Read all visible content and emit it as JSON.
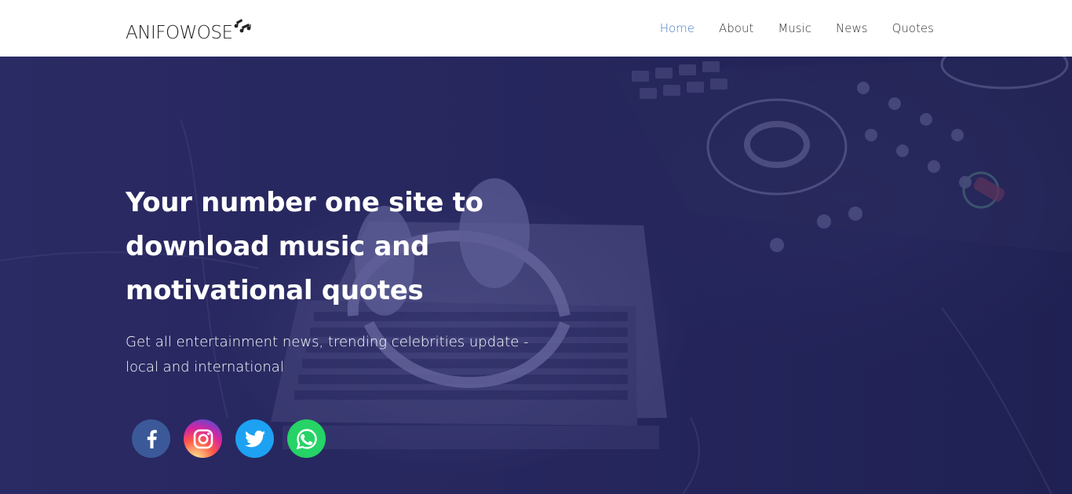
{
  "brand": {
    "name": "ANIFOWOSE"
  },
  "nav": {
    "items": [
      {
        "label": "Home",
        "active": true
      },
      {
        "label": "About",
        "active": false
      },
      {
        "label": "Music",
        "active": false
      },
      {
        "label": "News",
        "active": false
      },
      {
        "label": "Quotes",
        "active": false
      }
    ]
  },
  "hero": {
    "title": "Your number one site to download music and motivational quotes",
    "subtitle": "Get all entertainment news, trending celebrities update - local and international"
  },
  "socials": [
    {
      "icon": "facebook-icon",
      "color": "#3b5998"
    },
    {
      "icon": "instagram-icon",
      "color": "#d6249f"
    },
    {
      "icon": "twitter-icon",
      "color": "#1da1f2"
    },
    {
      "icon": "whatsapp-icon",
      "color": "#25d366"
    }
  ],
  "colors": {
    "nav_active": "#4a7cc6",
    "hero_overlay": "#23225a"
  }
}
